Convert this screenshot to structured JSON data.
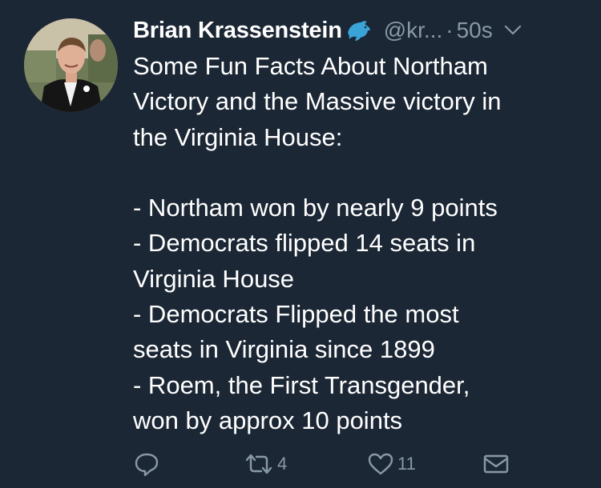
{
  "tweet": {
    "author": {
      "display_name": "Brian Krassenstein",
      "handle": "@kr...",
      "badge_icon": "dolphin-icon"
    },
    "separator": "·",
    "timestamp": "50s",
    "text": "Some Fun Facts About Northam\nVictory and the Massive victory in\nthe Virginia House:\n\n- Northam won by nearly 9 points\n- Democrats flipped 14 seats in\nVirginia House\n- Democrats Flipped the most\nseats in Virginia since 1899\n- Roem, the First Transgender,\nwon by approx 10 points",
    "actions": {
      "reply_icon": "reply-icon",
      "retweet_icon": "retweet-icon",
      "retweet_count": "4",
      "like_icon": "heart-icon",
      "like_count": "11",
      "message_icon": "envelope-icon"
    }
  },
  "colors": {
    "background": "#1c2735",
    "text": "#ffffff",
    "muted": "#8899a6",
    "dolphin": "#3aa3d8"
  }
}
